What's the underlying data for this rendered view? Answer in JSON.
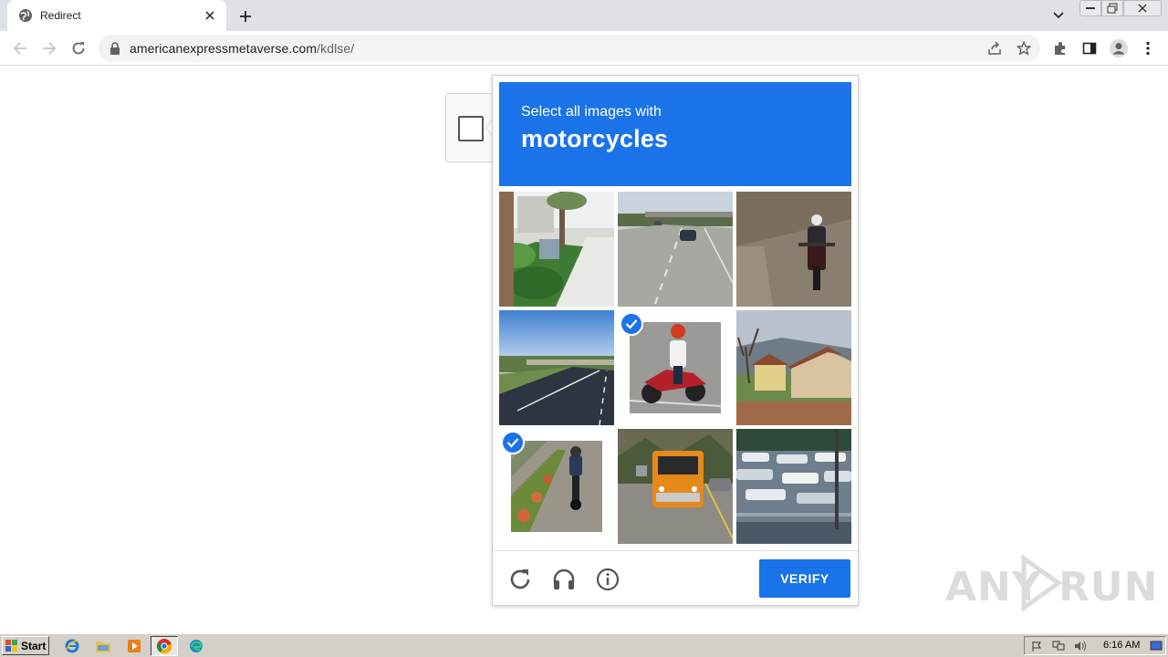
{
  "browser": {
    "tab_title": "Redirect",
    "url_host": "americanexpressmetaverse.com",
    "url_path": "/kdlse/"
  },
  "captcha": {
    "prompt_line1": "Select all images with",
    "prompt_target": "motorcycles",
    "verify_label": "VERIFY",
    "accent_color": "#1a73e8",
    "tiles": [
      {
        "subject": "palm trees and sidewalk",
        "selected": false
      },
      {
        "subject": "highway with car",
        "selected": false
      },
      {
        "subject": "motorcycle on road",
        "selected": false
      },
      {
        "subject": "highway overpass",
        "selected": false
      },
      {
        "subject": "motorcycle rider",
        "selected": true
      },
      {
        "subject": "house on hillside",
        "selected": false
      },
      {
        "subject": "motorcycle on path",
        "selected": true
      },
      {
        "subject": "school bus",
        "selected": false
      },
      {
        "subject": "marina with boats",
        "selected": false
      }
    ],
    "footer_icons": [
      "reload-icon",
      "audio-headphones-icon",
      "info-icon"
    ]
  },
  "watermark": {
    "text_left": "ANY",
    "text_right": "RUN"
  },
  "taskbar": {
    "start_label": "Start",
    "clock": "6:16 AM"
  }
}
